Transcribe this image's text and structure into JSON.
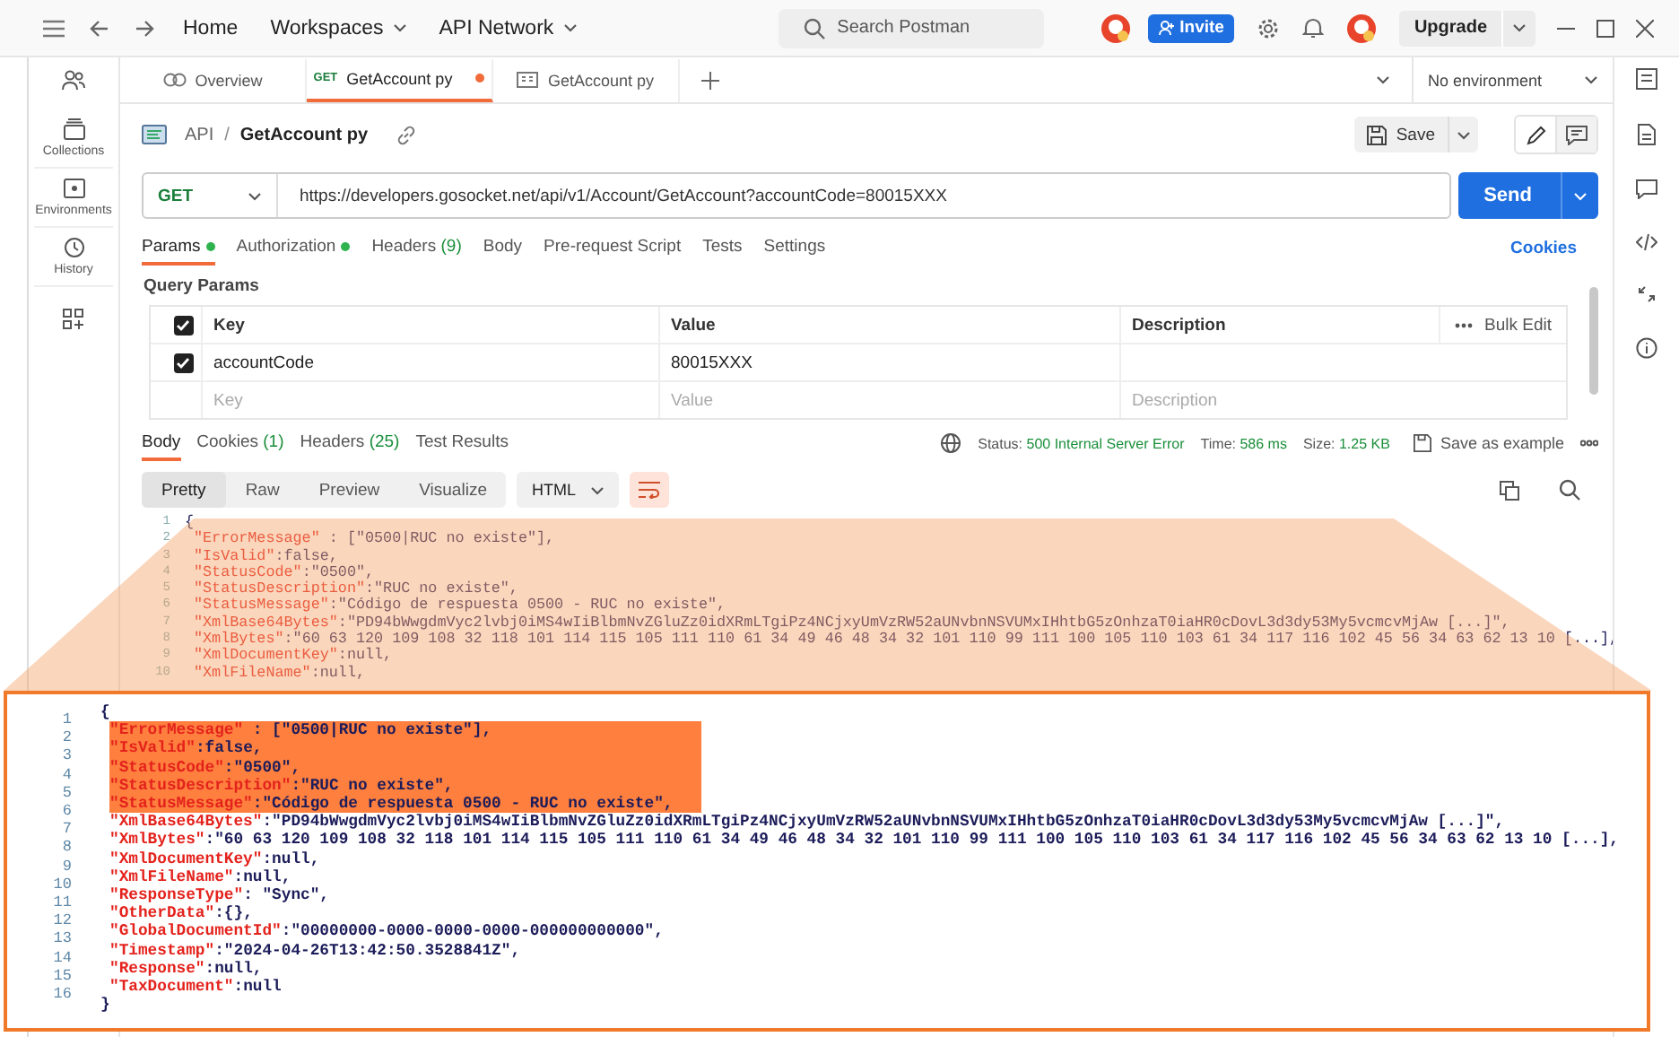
{
  "topbar": {
    "nav": [
      {
        "label": "Home",
        "dropdown": false
      },
      {
        "label": "Workspaces",
        "dropdown": true
      },
      {
        "label": "API Network",
        "dropdown": true
      }
    ],
    "search": {
      "placeholder": "Search Postman"
    },
    "invite": "Invite",
    "upgrade": "Upgrade"
  },
  "sidebar": {
    "items": [
      {
        "label": "Collections"
      },
      {
        "label": "Environments"
      },
      {
        "label": "History"
      }
    ]
  },
  "tabs": [
    {
      "kind": "overview",
      "label": "Overview",
      "selected": false,
      "unsaved": false
    },
    {
      "kind": "request",
      "method": "GET",
      "label": "GetAccount py",
      "selected": true,
      "unsaved": true
    },
    {
      "kind": "example",
      "label": "GetAccount py",
      "selected": false,
      "unsaved": false
    }
  ],
  "environment": "No environment",
  "breadcrumb": {
    "parent": "API",
    "separator": "/",
    "title": "GetAccount py"
  },
  "save": "Save",
  "request": {
    "method": "GET",
    "url": "https://developers.gosocket.net/api/v1/Account/GetAccount?accountCode=80015XXX",
    "send": "Send"
  },
  "request_tabs": [
    {
      "label": "Params",
      "dot": true,
      "selected": true
    },
    {
      "label": "Authorization",
      "dot": true,
      "selected": false
    },
    {
      "label": "Headers",
      "count": "(9)",
      "dot": false,
      "selected": false
    },
    {
      "label": "Body",
      "dot": false,
      "selected": false
    },
    {
      "label": "Pre-request Script",
      "dot": false,
      "selected": false
    },
    {
      "label": "Tests",
      "dot": false,
      "selected": false
    },
    {
      "label": "Settings",
      "dot": false,
      "selected": false
    }
  ],
  "cookies_link": "Cookies",
  "query_params": {
    "title": "Query Params",
    "all_checked": true,
    "columns": [
      "Key",
      "Value",
      "Description"
    ],
    "bulk_edit": "Bulk Edit",
    "rows": [
      {
        "key": "accountCode",
        "value": "80015XXX",
        "checked": true
      }
    ],
    "new_row": {
      "key_placeholder": "Key",
      "value_placeholder": "Value",
      "description_placeholder": "Description"
    }
  },
  "response_tabs": [
    {
      "label": "Body",
      "selected": true
    },
    {
      "label": "Cookies",
      "count": "(1)",
      "selected": false
    },
    {
      "label": "Headers",
      "count": "(25)",
      "selected": false
    },
    {
      "label": "Test Results",
      "selected": false
    }
  ],
  "response_meta": [
    {
      "label": "Status:",
      "value": "500 Internal Server Error"
    },
    {
      "label": "Time:",
      "value": "586 ms"
    },
    {
      "label": "Size:",
      "value": "1.25 KB"
    }
  ],
  "save_example": "Save as example",
  "view_modes": [
    {
      "label": "Pretty",
      "selected": true
    },
    {
      "label": "Raw",
      "selected": false
    },
    {
      "label": "Preview",
      "selected": false
    },
    {
      "label": "Visualize",
      "selected": false
    }
  ],
  "format": "HTML",
  "word_wrap": true,
  "response_code": {
    "line_numbers": [
      "1",
      "2",
      "3",
      "4",
      "5",
      "6",
      "7",
      "8",
      "9",
      "10"
    ],
    "lines": [
      {
        "kind": "brace",
        "text": "{"
      },
      {
        "kind": "pair",
        "key": "\"ErrorMessage\"",
        "text": " : [\"0500|RUC no existe\"],"
      },
      {
        "kind": "pair",
        "key": "\"IsValid\"",
        "text": ":false,"
      },
      {
        "kind": "pair",
        "key": "\"StatusCode\"",
        "text": ":\"0500\","
      },
      {
        "kind": "pair",
        "key": "\"StatusDescription\"",
        "text": ":\"RUC no existe\","
      },
      {
        "kind": "pair",
        "key": "\"StatusMessage\"",
        "text": ":\"Código de respuesta 0500 - RUC no existe\","
      },
      {
        "kind": "pair",
        "key": "\"XmlBase64Bytes\"",
        "text": ":\"PD94bWwgdmVyc2lvbj0iMS4wIiBlbmNvZGluZz0idXRmLTgiPz4NCjxyUmVzRW52aUNvbnNSVUMxIHhtbG5zOnhzaT0iaHR0cDovL3d3dy53My5vcmcvMjAw [...]\","
      },
      {
        "kind": "pair",
        "key": "\"XmlBytes\"",
        "text": ":\"60 63 120 109 108 32 118 101 114 115 105 111 110 61 34 49 46 48 34 32 101 110 99 111 100 105 110 103 61 34 117 116 102 45 56 34 63 62 13 10 [...],"
      },
      {
        "kind": "pair",
        "key": "\"XmlDocumentKey\"",
        "text": ":null,"
      },
      {
        "kind": "pair",
        "key": "\"XmlFileName\"",
        "text": ":null,"
      }
    ]
  },
  "callout": {
    "line_numbers": [
      "1",
      "2",
      "3",
      "4",
      "5",
      "6",
      "7",
      "8",
      "9",
      "10",
      "11",
      "12",
      "13",
      "14",
      "15",
      "16"
    ],
    "lines": [
      {
        "kind": "brace",
        "text": "{",
        "highlighted": false
      },
      {
        "kind": "pair",
        "key": "\"ErrorMessage\"",
        "text": " : [\"0500|RUC no existe\"],",
        "highlighted": true
      },
      {
        "kind": "pair",
        "key": "\"IsValid\"",
        "text": ":false,",
        "highlighted": true
      },
      {
        "kind": "pair",
        "key": "\"StatusCode\"",
        "text": ":\"0500\",",
        "highlighted": true
      },
      {
        "kind": "pair",
        "key": "\"StatusDescription\"",
        "text": ":\"RUC no existe\",",
        "highlighted": true
      },
      {
        "kind": "pair",
        "key": "\"StatusMessage\"",
        "text": ":\"Código de respuesta 0500 - RUC no existe\",",
        "highlighted": true
      },
      {
        "kind": "pair",
        "key": "\"XmlBase64Bytes\"",
        "text": ":\"PD94bWwgdmVyc2lvbj0iMS4wIiBlbmNvZGluZz0idXRmLTgiPz4NCjxyUmVzRW52aUNvbnNSVUMxIHhtbG5zOnhzaT0iaHR0cDovL3d3dy53My5vcmcvMjAw [...]\",",
        "highlighted": false
      },
      {
        "kind": "pair",
        "key": "\"XmlBytes\"",
        "text": ":\"60 63 120 109 108 32 118 101 114 115 105 111 110 61 34 49 46 48 34 32 101 110 99 111 100 105 110 103 61 34 117 116 102 45 56 34 63 62 13 10 [...],",
        "highlighted": false
      },
      {
        "kind": "pair",
        "key": "\"XmlDocumentKey\"",
        "text": ":null,",
        "highlighted": false
      },
      {
        "kind": "pair",
        "key": "\"XmlFileName\"",
        "text": ":null,",
        "highlighted": false
      },
      {
        "kind": "pair",
        "key": "\"ResponseType\"",
        "text": ": \"Sync\",",
        "highlighted": false
      },
      {
        "kind": "pair",
        "key": "\"OtherData\"",
        "text": ":{},",
        "highlighted": false
      },
      {
        "kind": "pair",
        "key": "\"GlobalDocumentId\"",
        "text": ":\"00000000-0000-0000-0000-000000000000\",",
        "highlighted": false
      },
      {
        "kind": "pair",
        "key": "\"Timestamp\"",
        "text": ":\"2024-04-26T13:42:50.3528841Z\",",
        "highlighted": false
      },
      {
        "kind": "pair",
        "key": "\"Response\"",
        "text": ":null,",
        "highlighted": false
      },
      {
        "kind": "pair",
        "key": "\"TaxDocument\"",
        "text": ":null",
        "highlighted": false
      },
      {
        "kind": "brace",
        "text": "}",
        "highlighted": false
      }
    ]
  }
}
